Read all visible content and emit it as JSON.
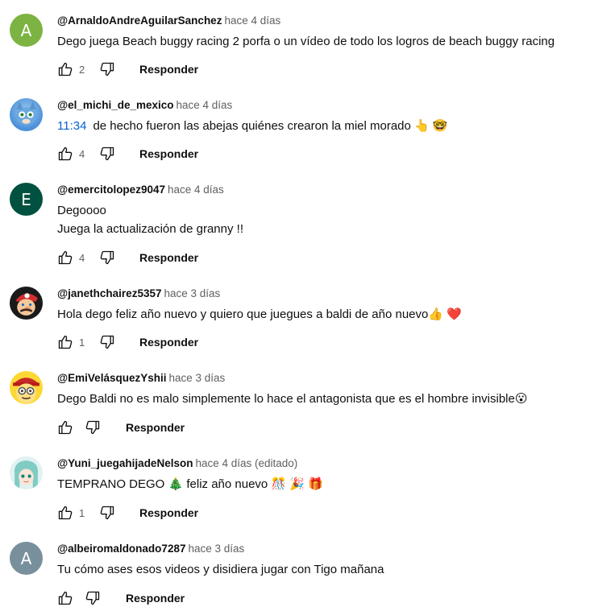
{
  "reply_label": "Responder",
  "comments": [
    {
      "avatar_letter": "A",
      "avatar_color": "#7cb342",
      "author": "@ArnaldoAndreAguilarSanchez",
      "time": "hace 4 días",
      "lines": [
        "Dego juega Beach buggy racing 2 porfa o un vídeo de todo los logros de beach buggy racing"
      ],
      "likes": "2"
    },
    {
      "avatar_letter": "",
      "avatar_color": "#4a90d9",
      "author": "@el_michi_de_mexico",
      "time": "hace 4 días",
      "timestamp_link": "11:34",
      "lines": [
        "de hecho fueron las abejas quiénes crearon la miel morado 👆 🤓"
      ],
      "likes": "4"
    },
    {
      "avatar_letter": "E",
      "avatar_color": "#00513f",
      "author": "@emercitolopez9047",
      "time": "hace 4 días",
      "lines": [
        "Degoooo",
        "Juega la actualización de granny !!"
      ],
      "likes": "4"
    },
    {
      "avatar_letter": "",
      "avatar_color": "#d32f2f",
      "author": "@janethchairez5357",
      "time": "hace 3 días",
      "lines": [
        "Hola dego feliz año nuevo y quiero que juegues a baldi de año nuevo👍 ❤️"
      ],
      "likes": "1"
    },
    {
      "avatar_letter": "",
      "avatar_color": "#c62828",
      "author": "@EmiVelásquezYshii",
      "time": "hace 3 días",
      "lines": [
        "Dego Baldi no es malo simplemente lo hace el antagonista que es el hombre invisible😮"
      ],
      "likes": ""
    },
    {
      "avatar_letter": "",
      "avatar_color": "#b2dfdb",
      "author": "@Yuni_juegahijadeNelson",
      "time": "hace 4 días (editado)",
      "lines": [
        "TEMPRANO DEGO 🎄  feliz año nuevo  🎊 🎉 🎁"
      ],
      "likes": "1"
    },
    {
      "avatar_letter": "A",
      "avatar_color": "#78909c",
      "author": "@albeiromaldonado7287",
      "time": "hace 3 días",
      "lines": [
        "Tu cómo ases esos videos y disidiera jugar con Tigo mañana"
      ],
      "likes": ""
    }
  ]
}
